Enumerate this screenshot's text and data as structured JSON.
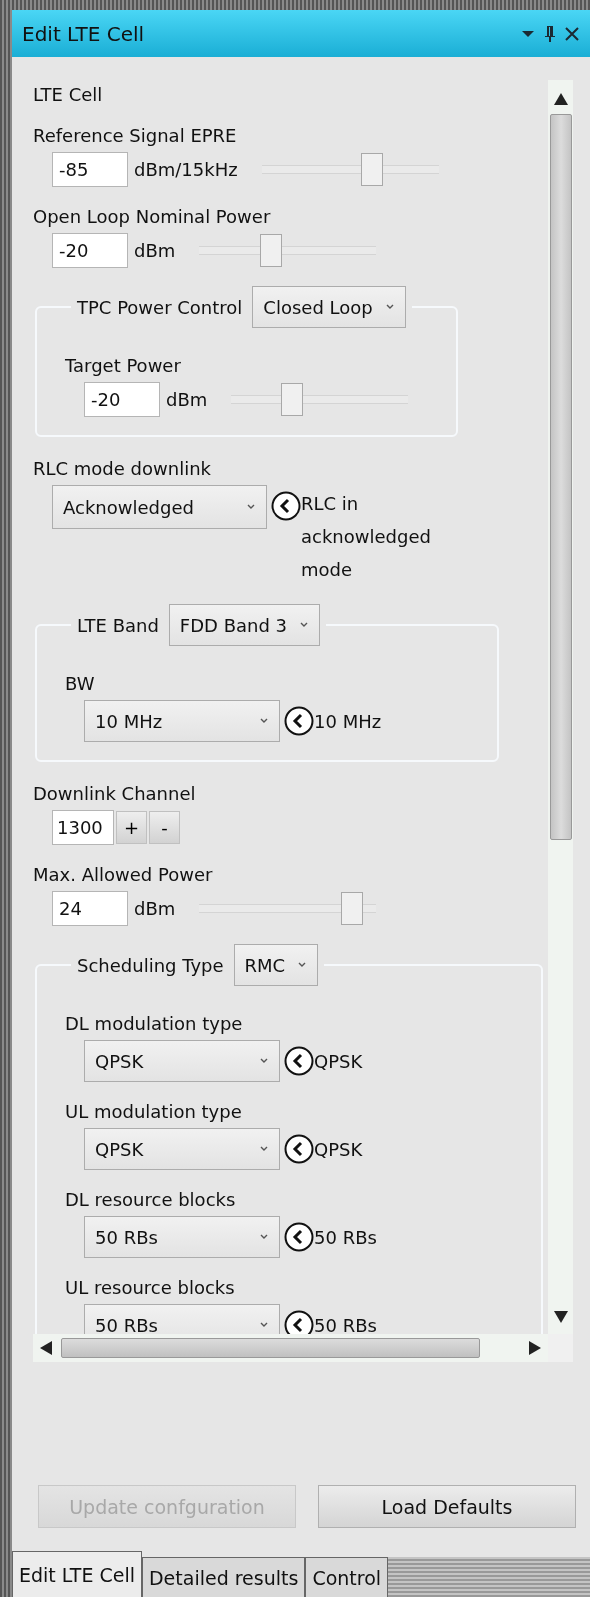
{
  "window": {
    "title": "Edit LTE Cell"
  },
  "section_title": "LTE Cell",
  "fields": [
    {
      "kind": "slider",
      "label": "Reference Signal EPRE",
      "value": "-85",
      "unit": "dBm/15kHz",
      "level": 0.63
    },
    {
      "kind": "slider",
      "label": "Open Loop Nominal Power",
      "value": "-20",
      "unit": "dBm",
      "level": 0.41
    },
    {
      "kind": "group",
      "legend": "TPC Power Control",
      "value": "Closed Loop",
      "children": [
        {
          "kind": "slider",
          "label": "Target Power",
          "value": "-20",
          "unit": "dBm",
          "level": 0.35
        }
      ]
    },
    {
      "kind": "select",
      "label": "RLC mode downlink",
      "value": "Acknowledged",
      "note": "RLC in acknowledged mode"
    },
    {
      "kind": "group",
      "legend": "LTE Band",
      "value": "FDD Band 3",
      "children": [
        {
          "kind": "select",
          "label": "BW",
          "value": "10 MHz",
          "note": "10 MHz"
        }
      ]
    },
    {
      "kind": "spin",
      "label": "Downlink Channel",
      "value": "1300",
      "plus": "+",
      "minus": "-"
    },
    {
      "kind": "slider",
      "label": "Max. Allowed Power",
      "value": "24",
      "unit": "dBm",
      "level": 0.87
    },
    {
      "kind": "group",
      "legend": "Scheduling Type",
      "value": "RMC",
      "children": [
        {
          "kind": "select",
          "label": "DL modulation type",
          "value": "QPSK",
          "note": "QPSK"
        },
        {
          "kind": "select",
          "label": "UL modulation type",
          "value": "QPSK",
          "note": "QPSK"
        },
        {
          "kind": "select",
          "label": "DL resource blocks",
          "value": "50 RBs",
          "note": "50 RBs"
        },
        {
          "kind": "select",
          "label": "UL resource blocks",
          "value": "50 RBs",
          "note": "50 RBs"
        }
      ]
    }
  ],
  "buttons": [
    {
      "label": "Update confguration",
      "disabled": true
    },
    {
      "label": "Load Defaults",
      "disabled": false
    }
  ],
  "tabs": [
    {
      "label": "Edit LTE Cell",
      "selected": true
    },
    {
      "label": "Detailed results",
      "selected": false
    },
    {
      "label": "Control",
      "selected": false
    }
  ]
}
